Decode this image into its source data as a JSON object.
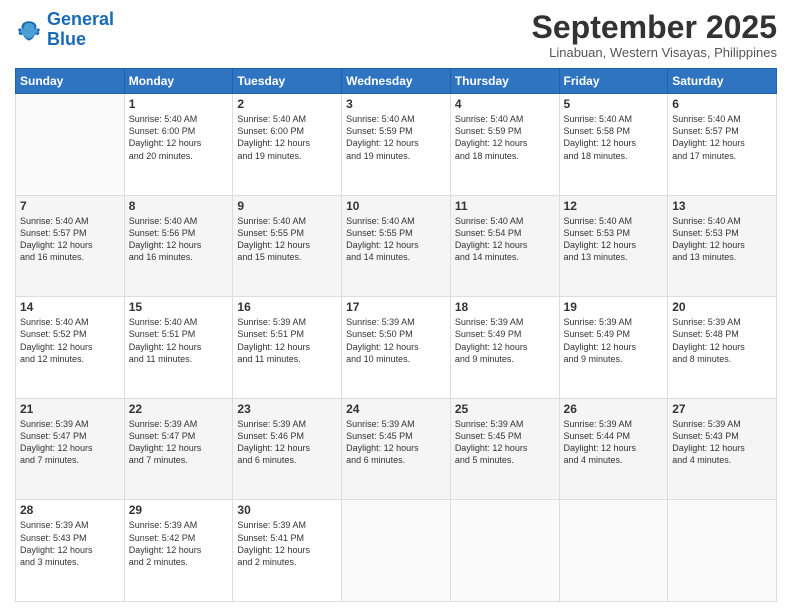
{
  "logo": {
    "line1": "General",
    "line2": "Blue"
  },
  "title": "September 2025",
  "location": "Linabuan, Western Visayas, Philippines",
  "days_header": [
    "Sunday",
    "Monday",
    "Tuesday",
    "Wednesday",
    "Thursday",
    "Friday",
    "Saturday"
  ],
  "weeks": [
    [
      {
        "day": "",
        "info": ""
      },
      {
        "day": "1",
        "info": "Sunrise: 5:40 AM\nSunset: 6:00 PM\nDaylight: 12 hours\nand 20 minutes."
      },
      {
        "day": "2",
        "info": "Sunrise: 5:40 AM\nSunset: 6:00 PM\nDaylight: 12 hours\nand 19 minutes."
      },
      {
        "day": "3",
        "info": "Sunrise: 5:40 AM\nSunset: 5:59 PM\nDaylight: 12 hours\nand 19 minutes."
      },
      {
        "day": "4",
        "info": "Sunrise: 5:40 AM\nSunset: 5:59 PM\nDaylight: 12 hours\nand 18 minutes."
      },
      {
        "day": "5",
        "info": "Sunrise: 5:40 AM\nSunset: 5:58 PM\nDaylight: 12 hours\nand 18 minutes."
      },
      {
        "day": "6",
        "info": "Sunrise: 5:40 AM\nSunset: 5:57 PM\nDaylight: 12 hours\nand 17 minutes."
      }
    ],
    [
      {
        "day": "7",
        "info": "Sunrise: 5:40 AM\nSunset: 5:57 PM\nDaylight: 12 hours\nand 16 minutes."
      },
      {
        "day": "8",
        "info": "Sunrise: 5:40 AM\nSunset: 5:56 PM\nDaylight: 12 hours\nand 16 minutes."
      },
      {
        "day": "9",
        "info": "Sunrise: 5:40 AM\nSunset: 5:55 PM\nDaylight: 12 hours\nand 15 minutes."
      },
      {
        "day": "10",
        "info": "Sunrise: 5:40 AM\nSunset: 5:55 PM\nDaylight: 12 hours\nand 14 minutes."
      },
      {
        "day": "11",
        "info": "Sunrise: 5:40 AM\nSunset: 5:54 PM\nDaylight: 12 hours\nand 14 minutes."
      },
      {
        "day": "12",
        "info": "Sunrise: 5:40 AM\nSunset: 5:53 PM\nDaylight: 12 hours\nand 13 minutes."
      },
      {
        "day": "13",
        "info": "Sunrise: 5:40 AM\nSunset: 5:53 PM\nDaylight: 12 hours\nand 13 minutes."
      }
    ],
    [
      {
        "day": "14",
        "info": "Sunrise: 5:40 AM\nSunset: 5:52 PM\nDaylight: 12 hours\nand 12 minutes."
      },
      {
        "day": "15",
        "info": "Sunrise: 5:40 AM\nSunset: 5:51 PM\nDaylight: 12 hours\nand 11 minutes."
      },
      {
        "day": "16",
        "info": "Sunrise: 5:39 AM\nSunset: 5:51 PM\nDaylight: 12 hours\nand 11 minutes."
      },
      {
        "day": "17",
        "info": "Sunrise: 5:39 AM\nSunset: 5:50 PM\nDaylight: 12 hours\nand 10 minutes."
      },
      {
        "day": "18",
        "info": "Sunrise: 5:39 AM\nSunset: 5:49 PM\nDaylight: 12 hours\nand 9 minutes."
      },
      {
        "day": "19",
        "info": "Sunrise: 5:39 AM\nSunset: 5:49 PM\nDaylight: 12 hours\nand 9 minutes."
      },
      {
        "day": "20",
        "info": "Sunrise: 5:39 AM\nSunset: 5:48 PM\nDaylight: 12 hours\nand 8 minutes."
      }
    ],
    [
      {
        "day": "21",
        "info": "Sunrise: 5:39 AM\nSunset: 5:47 PM\nDaylight: 12 hours\nand 7 minutes."
      },
      {
        "day": "22",
        "info": "Sunrise: 5:39 AM\nSunset: 5:47 PM\nDaylight: 12 hours\nand 7 minutes."
      },
      {
        "day": "23",
        "info": "Sunrise: 5:39 AM\nSunset: 5:46 PM\nDaylight: 12 hours\nand 6 minutes."
      },
      {
        "day": "24",
        "info": "Sunrise: 5:39 AM\nSunset: 5:45 PM\nDaylight: 12 hours\nand 6 minutes."
      },
      {
        "day": "25",
        "info": "Sunrise: 5:39 AM\nSunset: 5:45 PM\nDaylight: 12 hours\nand 5 minutes."
      },
      {
        "day": "26",
        "info": "Sunrise: 5:39 AM\nSunset: 5:44 PM\nDaylight: 12 hours\nand 4 minutes."
      },
      {
        "day": "27",
        "info": "Sunrise: 5:39 AM\nSunset: 5:43 PM\nDaylight: 12 hours\nand 4 minutes."
      }
    ],
    [
      {
        "day": "28",
        "info": "Sunrise: 5:39 AM\nSunset: 5:43 PM\nDaylight: 12 hours\nand 3 minutes."
      },
      {
        "day": "29",
        "info": "Sunrise: 5:39 AM\nSunset: 5:42 PM\nDaylight: 12 hours\nand 2 minutes."
      },
      {
        "day": "30",
        "info": "Sunrise: 5:39 AM\nSunset: 5:41 PM\nDaylight: 12 hours\nand 2 minutes."
      },
      {
        "day": "",
        "info": ""
      },
      {
        "day": "",
        "info": ""
      },
      {
        "day": "",
        "info": ""
      },
      {
        "day": "",
        "info": ""
      }
    ]
  ]
}
